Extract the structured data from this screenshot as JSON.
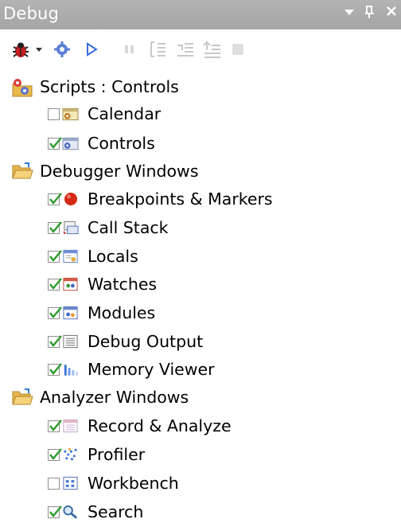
{
  "panel": {
    "title": "Debug"
  },
  "window_controls": {
    "dropdown": "▼",
    "pin": "⊐",
    "close": "✕"
  },
  "toolbar": {
    "buttons": [
      "bug-dropdown",
      "settings",
      "run",
      "pause",
      "step-into",
      "step-over",
      "step-out",
      "stop"
    ]
  },
  "tree": {
    "groups": [
      {
        "label": "Scripts : Controls",
        "items": [
          {
            "label": "Calendar",
            "checked": false,
            "icon": "calendar-form-icon"
          },
          {
            "label": "Controls",
            "checked": true,
            "icon": "controls-form-icon"
          }
        ]
      },
      {
        "label": "Debugger Windows",
        "items": [
          {
            "label": "Breakpoints & Markers",
            "checked": true,
            "icon": "breakpoint-icon"
          },
          {
            "label": "Call Stack",
            "checked": true,
            "icon": "call-stack-icon"
          },
          {
            "label": "Locals",
            "checked": true,
            "icon": "locals-icon"
          },
          {
            "label": "Watches",
            "checked": true,
            "icon": "watches-icon"
          },
          {
            "label": "Modules",
            "checked": true,
            "icon": "modules-icon"
          },
          {
            "label": "Debug Output",
            "checked": true,
            "icon": "debug-output-icon"
          },
          {
            "label": "Memory Viewer",
            "checked": true,
            "icon": "memory-viewer-icon"
          }
        ]
      },
      {
        "label": "Analyzer Windows",
        "items": [
          {
            "label": "Record & Analyze",
            "checked": true,
            "icon": "record-analyze-icon"
          },
          {
            "label": "Profiler",
            "checked": true,
            "icon": "profiler-icon"
          },
          {
            "label": "Workbench",
            "checked": false,
            "icon": "workbench-icon"
          },
          {
            "label": "Search",
            "checked": true,
            "icon": "search-icon"
          }
        ]
      }
    ]
  }
}
